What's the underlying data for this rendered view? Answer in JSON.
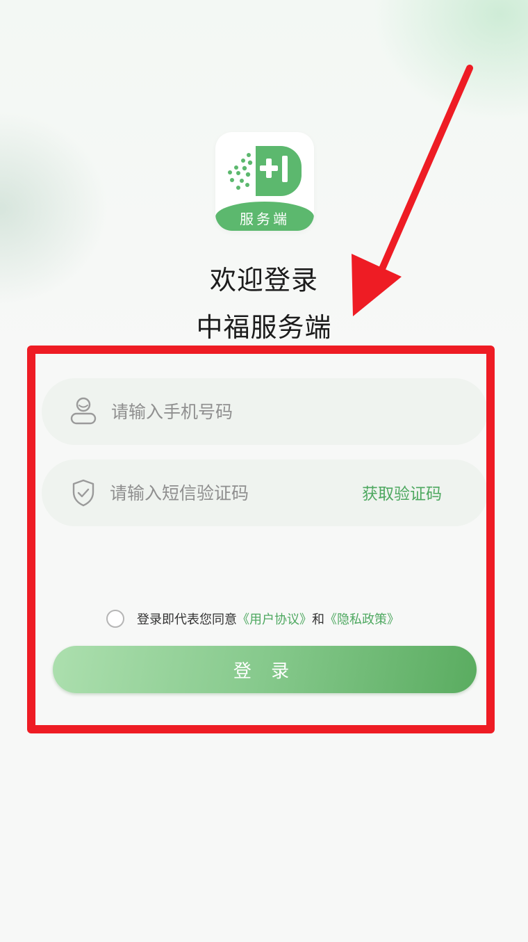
{
  "logo": {
    "band_text": "服务端"
  },
  "header": {
    "welcome": "欢迎登录",
    "app_name": "中福服务端"
  },
  "form": {
    "phone_placeholder": "请输入手机号码",
    "code_placeholder": "请输入短信验证码",
    "get_code_label": "获取验证码"
  },
  "agreement": {
    "prefix": "登录即代表您同意",
    "user_agreement": "《用户协议》",
    "conjunction": "和",
    "privacy_policy": "《隐私政策》",
    "checked": false
  },
  "login_button": {
    "label": "登 录"
  },
  "colors": {
    "accent": "#4ea860",
    "logo_green": "#5cb86e",
    "annotation_red": "#ee1c24"
  },
  "icons": {
    "phone_field": "user-icon",
    "code_field": "shield-check-icon"
  }
}
